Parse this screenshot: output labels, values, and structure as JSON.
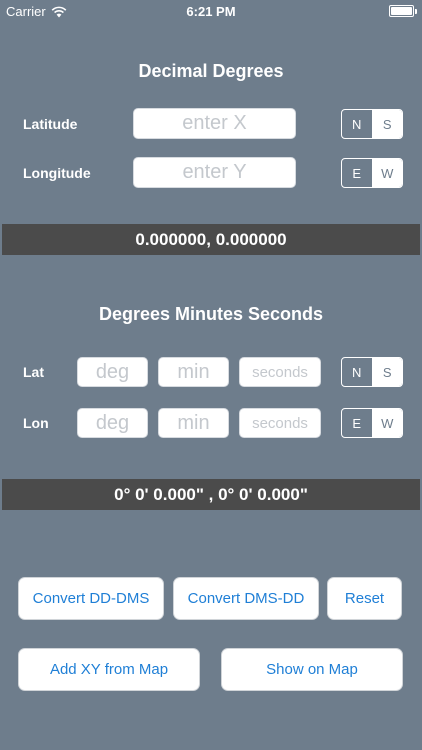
{
  "status_bar": {
    "carrier": "Carrier",
    "time": "6:21 PM"
  },
  "decimal": {
    "title": "Decimal Degrees",
    "latitude_label": "Latitude",
    "longitude_label": "Longitude",
    "latitude_placeholder": "enter X",
    "longitude_placeholder": "enter Y",
    "ns": {
      "options": [
        "N",
        "S"
      ],
      "selected": "S"
    },
    "ew": {
      "options": [
        "E",
        "W"
      ],
      "selected": "W"
    },
    "result": "0.000000, 0.000000"
  },
  "dms": {
    "title": "Degrees Minutes Seconds",
    "lat_label": "Lat",
    "lon_label": "Lon",
    "deg_placeholder": "deg",
    "min_placeholder": "min",
    "sec_placeholder": "seconds",
    "ns": {
      "options": [
        "N",
        "S"
      ],
      "selected": "S"
    },
    "ew": {
      "options": [
        "E",
        "W"
      ],
      "selected": "W"
    },
    "result": "0° 0' 0.000\" , 0° 0' 0.000\""
  },
  "buttons": {
    "convert_dd_dms": "Convert DD-DMS",
    "convert_dms_dd": "Convert DMS-DD",
    "reset": "Reset",
    "add_xy": "Add XY from Map",
    "show_on_map": "Show on Map"
  },
  "icons": {
    "wifi": "wifi-icon",
    "battery": "battery-icon"
  },
  "colors": {
    "background": "#6e7d8c",
    "result_bar": "#4b4b4b",
    "button_text": "#1f7fd6"
  }
}
